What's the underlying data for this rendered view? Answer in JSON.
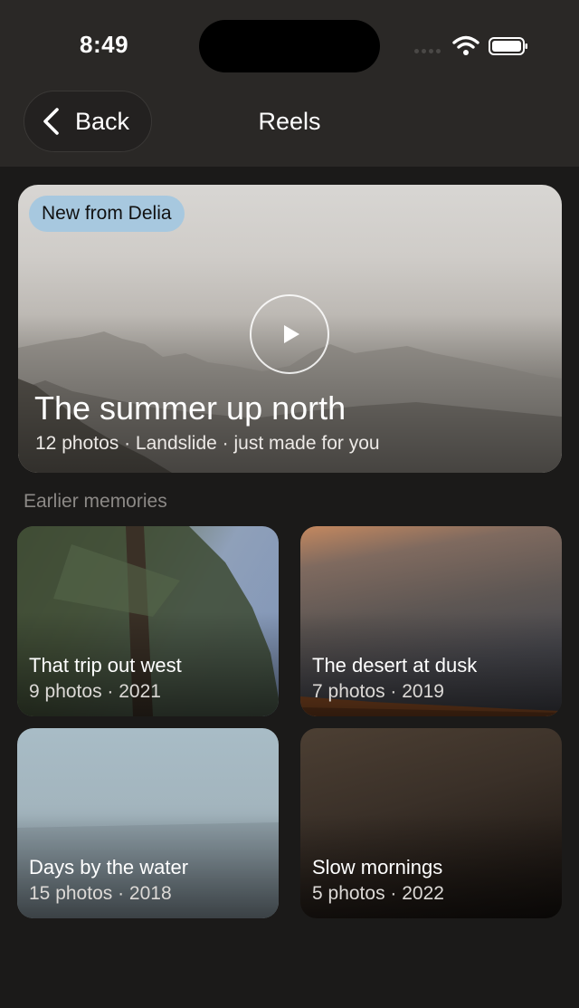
{
  "status_bar": {
    "time": "8:49"
  },
  "header": {
    "back_label": "Back",
    "title": "Reels"
  },
  "hero": {
    "badge": "New from Delia",
    "title": "The summer up north",
    "subtitle": "12 photos · Landslide · just made for you"
  },
  "section_label": "Earlier memories",
  "memories": [
    {
      "title": "That trip out west",
      "subtitle": "9 photos · 2021"
    },
    {
      "title": "The desert at dusk",
      "subtitle": "7 photos · 2019"
    },
    {
      "title": "Days by the water",
      "subtitle": "15 photos · 2018"
    },
    {
      "title": "Slow mornings",
      "subtitle": "5 photos · 2022"
    }
  ],
  "icons": {
    "back": "chevron-left-icon",
    "play": "play-icon",
    "wifi": "wifi-icon",
    "battery": "battery-icon"
  },
  "colors": {
    "background": "#1b1a19",
    "header": "#2a2826",
    "badge": "#a7c8df",
    "muted_text": "#8c8986"
  }
}
